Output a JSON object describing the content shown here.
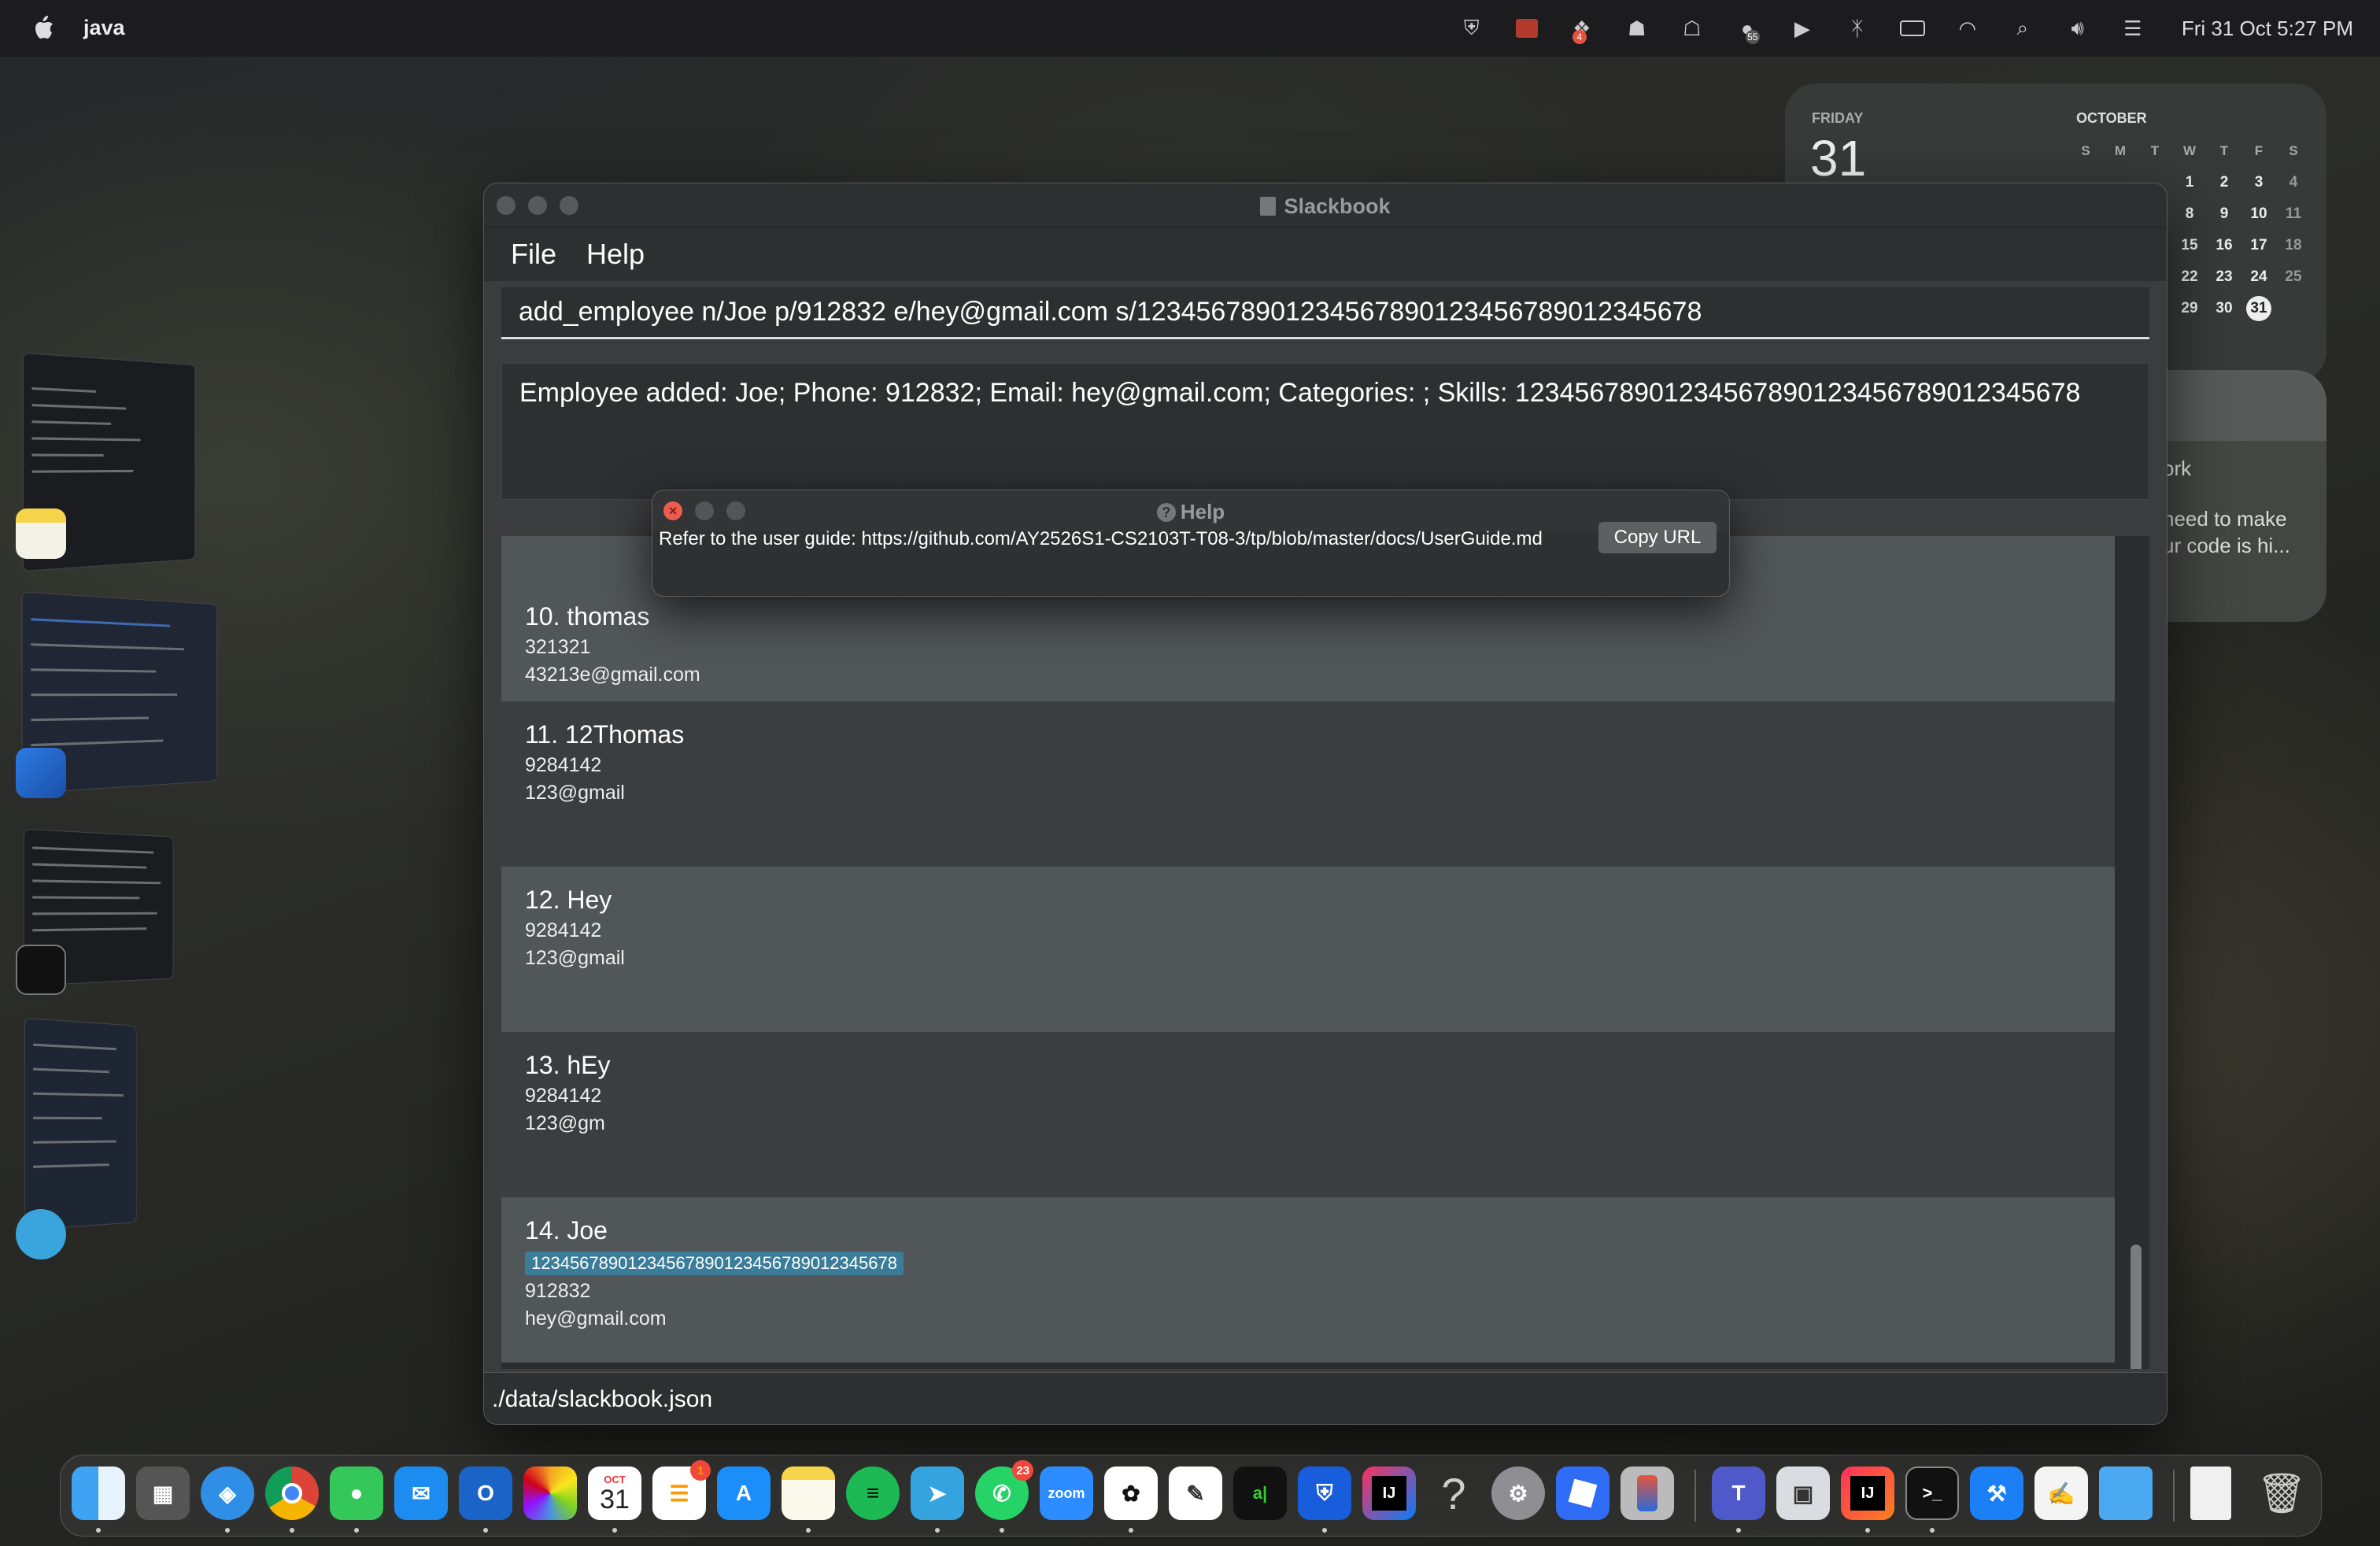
{
  "menubar": {
    "app_name": "java",
    "clock": "Fri 31 Oct  5:27 PM",
    "battery_badge": "4",
    "notif_badge": "55"
  },
  "calendar": {
    "weekday": "FRIDAY",
    "date": "31",
    "month": "OCTOBER",
    "headers": [
      "S",
      "M",
      "T",
      "W",
      "T",
      "F",
      "S"
    ],
    "weeks": [
      [
        "",
        "",
        "",
        "1",
        "2",
        "3",
        "4"
      ],
      [
        "",
        "",
        "",
        "8",
        "9",
        "10",
        "11"
      ],
      [
        "",
        "",
        "",
        "15",
        "16",
        "17",
        "18"
      ],
      [
        "",
        "",
        "",
        "22",
        "23",
        "24",
        "25"
      ],
      [
        "",
        "",
        "",
        "29",
        "30",
        "31",
        ""
      ]
    ],
    "today": "31"
  },
  "reminders": {
    "line1": "ork",
    "line2a": "need to make",
    "line2b": "ur code is hi..."
  },
  "window": {
    "title": "Slackbook",
    "menu": [
      "File",
      "Help"
    ],
    "command": "add_employee n/Joe p/912832 e/hey@gmail.com s/12345678901234567890123456789012345678",
    "result": "Employee added: Joe; Phone: 912832; Email: hey@gmail.com; Categories: ; Skills: 12345678901234567890123456789012345678",
    "storage_path": "./data/slackbook.json"
  },
  "employees": [
    {
      "name": "10. thomas",
      "phone": "321321",
      "email": "43213e@gmail.com",
      "skill": ""
    },
    {
      "name": "11. 12Thomas",
      "phone": "9284142",
      "email": "123@gmail",
      "skill": ""
    },
    {
      "name": "12. Hey",
      "phone": "9284142",
      "email": "123@gmail",
      "skill": ""
    },
    {
      "name": "13. hEy",
      "phone": "9284142",
      "email": "123@gm",
      "skill": ""
    },
    {
      "name": "14. Joe",
      "phone": "912832",
      "email": "hey@gmail.com",
      "skill": "12345678901234567890123456789012345678"
    }
  ],
  "help_dialog": {
    "title": "Help",
    "message": "Refer to the user guide: https://github.com/AY2526S1-CS2103T-T08-3/tp/blob/master/docs/UserGuide.md",
    "copy_button": "Copy URL"
  },
  "dock": {
    "apps": [
      "finder",
      "launchpad",
      "safari",
      "chrome",
      "messages",
      "mail",
      "outlook",
      "photos",
      "calendar",
      "reminders",
      "app-store",
      "notes",
      "spotify",
      "telegram",
      "whatsapp",
      "zoom",
      "chatgpt",
      "freeform",
      "intellij-ce",
      "bitwarden",
      "intellij",
      "help",
      "system-settings",
      "roblox",
      "iphone-mirroring",
      "teams",
      "preview",
      "intellij-ultimate",
      "terminal",
      "xcode",
      "textedit",
      "folder",
      "document",
      "trash"
    ],
    "calendar_month": "OCT",
    "calendar_day": "31",
    "reminders_badge": "1",
    "whatsapp_badge": "23",
    "zoom_label": "zoom"
  }
}
